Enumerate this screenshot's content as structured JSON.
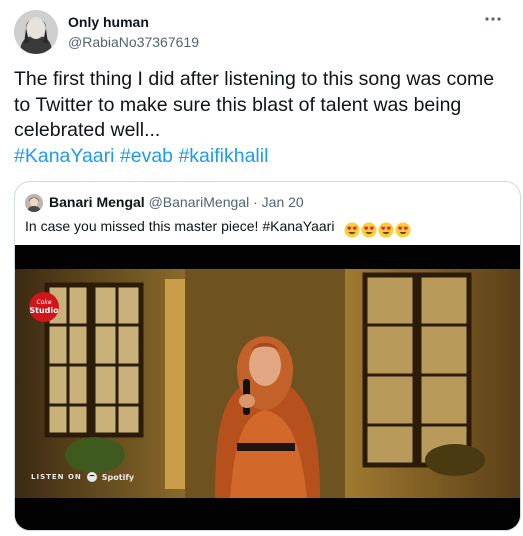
{
  "author": {
    "name": "Only human",
    "handle": "@RabiaNo37367619"
  },
  "tweet": {
    "text": "The first thing I did after listening to this song was come to Twitter to make sure this blast of talent was being celebrated well...",
    "hashtags": [
      "#KanaYaari",
      "#evab",
      "#kaifikhalil"
    ]
  },
  "quote": {
    "name": "Banari Mengal",
    "handle": "@BanariMengal",
    "separator": "·",
    "date": "Jan 20",
    "text": "In case you missed this master piece! #KanaYaari",
    "emoji_count": 4,
    "emoji_name": "heart-eyes-emoji"
  },
  "media": {
    "logo_top": "Coke",
    "logo_bottom": "Studio",
    "listen_on": "LISTEN ON",
    "spotify": "Spotify"
  },
  "colors": {
    "link": "#1d9bf0",
    "secondary_text": "#536471",
    "border": "#cfd9de"
  }
}
